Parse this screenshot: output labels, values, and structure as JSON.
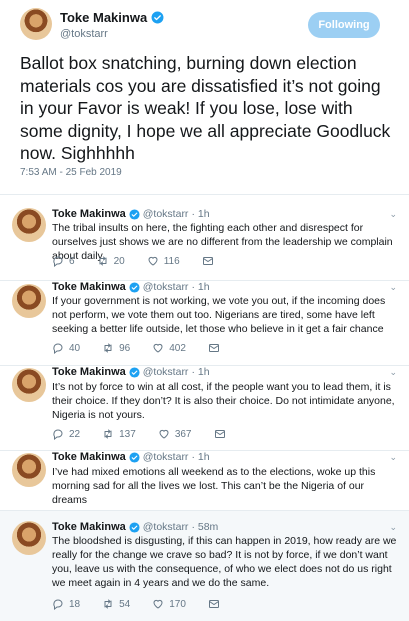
{
  "main_tweet": {
    "author_name": "Toke Makinwa",
    "handle": "@tokstarr",
    "follow_label": "Following",
    "text": "Ballot box snatching, burning down election materials cos you are dissatisfied it’s not going in your Favor is weak! If you lose, lose with some dignity, I hope we all appreciate Goodluck now. Sighhhhh",
    "timestamp": "7:53 AM - 25 Feb 2019"
  },
  "replies": [
    {
      "author_name": "Toke Makinwa",
      "handle": "@tokstarr",
      "age": "· 1h",
      "text": "The tribal insults on here, the fighting each other and disrespect for ourselves just shows we are no different from the leadership we complain about daily",
      "replies_count": "6",
      "retweets_count": "20",
      "likes_count": "116"
    },
    {
      "author_name": "Toke Makinwa",
      "handle": "@tokstarr",
      "age": "· 1h",
      "text": "If your government is not working, we vote you out, if the incoming does not perform, we vote them out too. Nigerians are tired, some have left seeking a better life outside, let those who believe in it get a fair chance",
      "replies_count": "40",
      "retweets_count": "96",
      "likes_count": "402"
    },
    {
      "author_name": "Toke Makinwa",
      "handle": "@tokstarr",
      "age": "· 1h",
      "text": "It’s not by force to win at all cost, if the people want you to lead them, it is their choice. If they don’t? It is also their choice. Do not intimidate anyone, Nigeria is not yours.",
      "replies_count": "22",
      "retweets_count": "137",
      "likes_count": "367"
    },
    {
      "author_name": "Toke Makinwa",
      "handle": "@tokstarr",
      "age": "· 1h",
      "text": "I’ve had mixed emotions all weekend as to the elections, woke up this morning sad for all the lives we lost. This can’t be the Nigeria of our dreams",
      "replies_count": "",
      "retweets_count": "",
      "likes_count": ""
    },
    {
      "author_name": "Toke Makinwa",
      "handle": "@tokstarr",
      "age": "· 58m",
      "text": "The bloodshed is disgusting, if this can happen in 2019, how ready are we really for the change we crave so bad? It is not by force, if we don’t want you, leave us with the consequence, of who we elect does not do us right we meet again in 4 years and we do the same.",
      "replies_count": "18",
      "retweets_count": "54",
      "likes_count": "170"
    }
  ],
  "colors": {
    "text": "#14171a",
    "secondary": "#657786",
    "verified": "#1da1f2",
    "follow_button": "#9ccff3",
    "divider": "#e6ecf0",
    "highlight_bg": "#f5f8fa"
  },
  "icons": [
    "verified-badge-icon",
    "reply-icon",
    "retweet-icon",
    "like-icon",
    "message-icon",
    "chevron-down-icon"
  ]
}
